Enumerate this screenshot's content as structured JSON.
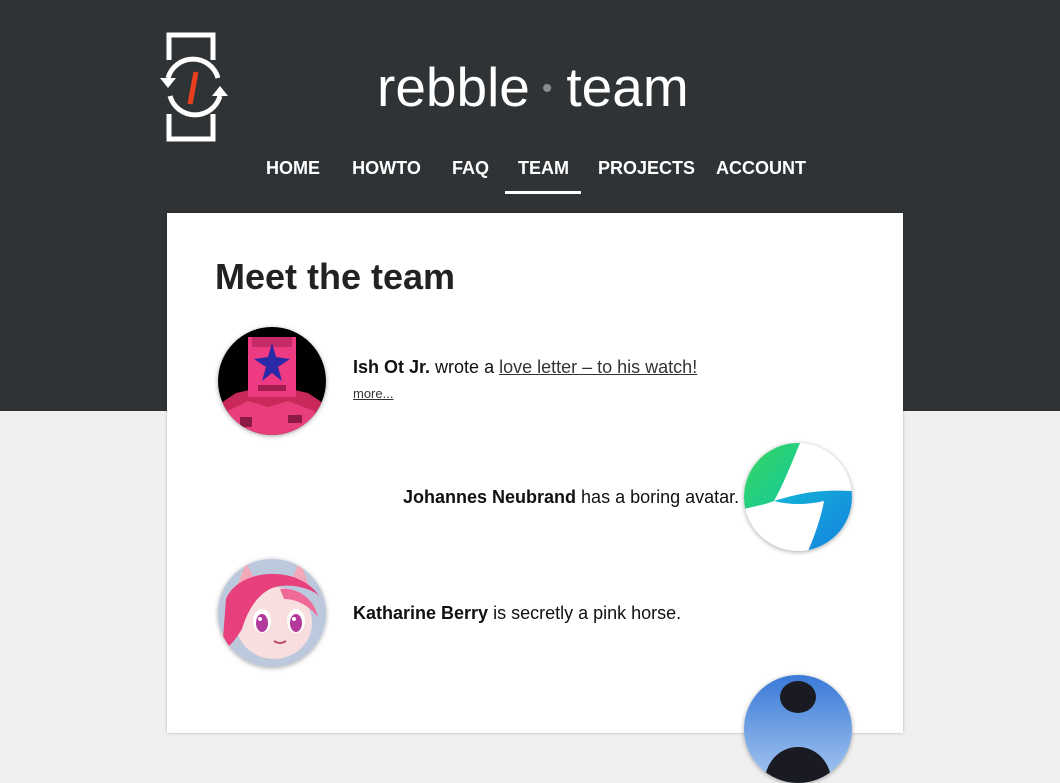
{
  "site": {
    "name": "rebble",
    "separator": "•",
    "section": "team"
  },
  "nav": {
    "items": [
      {
        "label": "HOME"
      },
      {
        "label": "HOWTO"
      },
      {
        "label": "FAQ"
      },
      {
        "label": "TEAM",
        "active": true
      },
      {
        "label": "PROJECTS"
      },
      {
        "label": "ACCOUNT"
      }
    ]
  },
  "main": {
    "title": "Meet the team",
    "members": [
      {
        "name": "Ish Ot Jr.",
        "text_before": "wrote a",
        "link": "love letter – to his watch!",
        "more": "more...",
        "avatar": "pixel-art-pink-figure"
      },
      {
        "name": "Johannes Neubrand",
        "text_after": "has a boring avatar.",
        "avatar": "green-blue-pinwheel"
      },
      {
        "name": "Katharine Berry",
        "text_after": "is secretly a pink horse.",
        "avatar": "pink-pony-illustration"
      },
      {
        "avatar": "person-silhouette-sky"
      }
    ]
  },
  "colors": {
    "header_bg": "#303335",
    "page_bg": "#f0f0f0",
    "card_bg": "#ffffff",
    "logo_accent": "#e8401c"
  }
}
